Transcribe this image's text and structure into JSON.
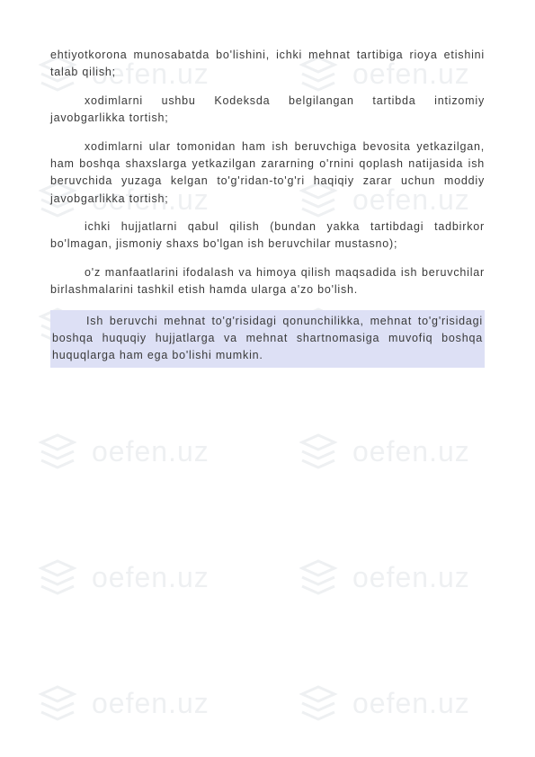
{
  "watermark": {
    "text": "oefen.uz"
  },
  "paragraphs": {
    "p1": "ehtiyotkorona munosabatda bo'lishini, ichki mehnat tartibiga rioya etishini talab qilish;",
    "p2": "xodimlarni ushbu Kodeksda belgilangan tartibda intizomiy javobgarlikka tortish;",
    "p3": "xodimlarni ular tomonidan ham ish beruvchiga bevosita yetkazilgan, ham boshqa shaxslarga yetkazilgan zararning o'rnini qoplash natijasida ish beruvchida yuzaga kelgan to'g'ridan-to'g'ri haqiqiy zarar uchun moddiy javobgarlikka tortish;",
    "p4": "ichki hujjatlarni qabul qilish (bundan yakka tartibdagi tadbirkor bo'lmagan, jismoniy shaxs bo'lgan ish beruvchilar mustasno);",
    "p5": "o'z manfaatlarini ifodalash va himoya qilish maqsadida ish beruvchilar birlashmalarini tashkil etish hamda ularga a'zo bo'lish.",
    "p6": "Ish beruvchi mehnat to'g'risidagi qonunchilikka, mehnat to'g'risidagi boshqa huquqiy hujjatlarga va mehnat shartnomasiga muvofiq boshqa huquqlarga ham ega bo'lishi mumkin."
  }
}
